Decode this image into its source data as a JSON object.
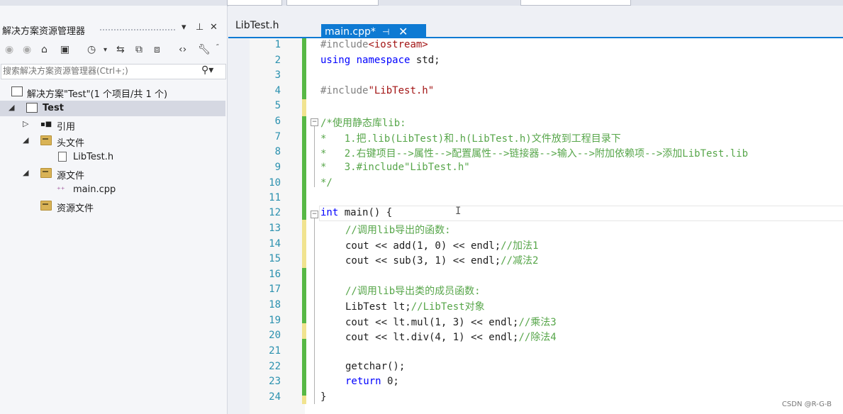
{
  "solution_explorer": {
    "title": "解决方案资源管理器",
    "search_placeholder": "搜索解决方案资源管理器(Ctrl+;)",
    "tree": [
      {
        "label": "解决方案\"Test\"(1 个项目/共 1 个)"
      },
      {
        "label": "Test"
      },
      {
        "label": "引用"
      },
      {
        "label": "头文件"
      },
      {
        "label": "LibTest.h"
      },
      {
        "label": "源文件"
      },
      {
        "label": "main.cpp"
      },
      {
        "label": "资源文件"
      }
    ]
  },
  "tabs": [
    {
      "label": "LibTest.h"
    },
    {
      "label": "main.cpp*"
    }
  ],
  "line_numbers": [
    "1",
    "2",
    "3",
    "4",
    "5",
    "6",
    "7",
    "8",
    "9",
    "10",
    "11",
    "12",
    "13",
    "14",
    "15",
    "16",
    "17",
    "18",
    "19",
    "20",
    "21",
    "22",
    "23",
    "24"
  ],
  "code": {
    "l1_dir": "#include",
    "l1_hdr": "<iostream>",
    "l2_using": "using",
    "l2_ns": "namespace",
    "l2_rest": " std;",
    "l4_dir": "#include",
    "l4_hdr": "\"LibTest.h\"",
    "l6": "/*使用静态库lib:",
    "l7": "*   1.把.lib(LibTest)和.h(LibTest.h)文件放到工程目录下",
    "l8": "*   2.右键项目-->属性-->配置属性-->链接器-->输入-->附加依赖项-->添加LibTest.lib",
    "l9": "*   3.#include\"LibTest.h\"",
    "l10": "*/",
    "l12_kw": "int",
    "l12_rest": " main() {",
    "l13": "//调用lib导出的函数:",
    "l14_code": "cout << add(1, 0) << endl;",
    "l14_cmt": "//加法1",
    "l15_code": "cout << sub(3, 1) << endl;",
    "l15_cmt": "//减法2",
    "l17": "//调用lib导出类的成员函数:",
    "l18_code": "LibTest lt;",
    "l18_cmt": "//LibTest对象",
    "l19_code": "cout << lt.mul(1, 3) << endl;",
    "l19_cmt": "//乘法3",
    "l20_code": "cout << lt.div(4, 1) << endl;",
    "l20_cmt": "//除法4",
    "l22": "getchar();",
    "l23_kw": "return",
    "l23_rest": " 0;",
    "l24": "}"
  },
  "watermark": "CSDN @R-G-B",
  "colors": {
    "accent": "#0e7ad3",
    "comment": "#57a64a",
    "keyword": "#0000ff",
    "string": "#a31515",
    "line_number": "#2b91af",
    "changed_bar": "#57b845",
    "unsaved_bar": "#f1e38f"
  }
}
